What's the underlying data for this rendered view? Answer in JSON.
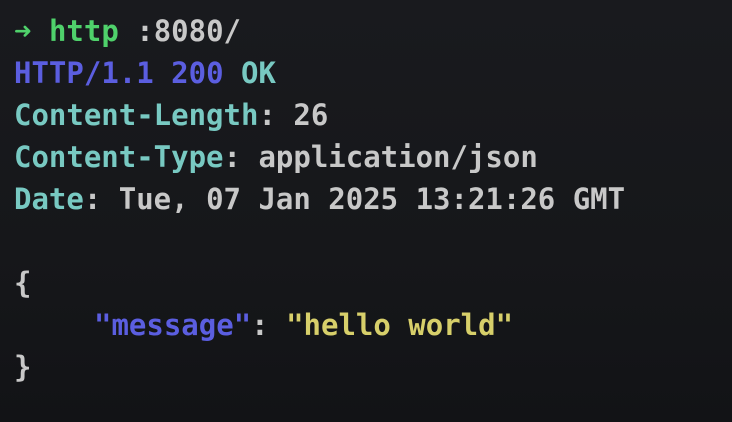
{
  "command": {
    "prompt": "➜",
    "program": "http",
    "argument": ":8080/"
  },
  "response": {
    "protocol": "HTTP",
    "version": "1.1",
    "status_code": "200",
    "status_text": "OK"
  },
  "headers": [
    {
      "key": "Content-Length",
      "value": "26"
    },
    {
      "key": "Content-Type",
      "value": "application/json"
    },
    {
      "key": "Date",
      "value": "Tue, 07 Jan 2025 13:21:26 GMT"
    }
  ],
  "body": {
    "open_brace": "{",
    "close_brace": "}",
    "key": "message",
    "value": "hello world"
  },
  "colors": {
    "background": "#17181b",
    "command_green": "#4fd16b",
    "blue": "#5b5ee0",
    "teal": "#78c9c2",
    "yellow": "#d7cf6a",
    "text": "#c8c8c8"
  }
}
